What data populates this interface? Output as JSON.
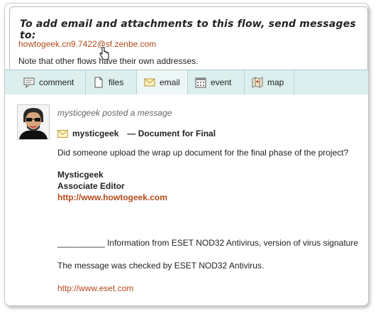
{
  "info": {
    "title": "To add email and attachments to this flow, send messages to:",
    "email_address": "howtogeek.cn9.7422@sf.zenbe.com",
    "note": "Note that other flows have their own addresses."
  },
  "tabs": [
    {
      "label": "comment",
      "icon": "comment-icon",
      "active": false
    },
    {
      "label": "files",
      "icon": "file-icon",
      "active": false
    },
    {
      "label": "email",
      "icon": "envelope-icon",
      "active": true
    },
    {
      "label": "event",
      "icon": "calendar-icon",
      "active": false
    },
    {
      "label": "map",
      "icon": "map-icon",
      "active": false
    }
  ],
  "post": {
    "header": "mysticgeek posted a message",
    "sender": "mysticgeek",
    "subject": "— Document for Final",
    "body": "Did someone upload the wrap up document for the final phase of the project?",
    "signature_name": "Mysticgeek",
    "signature_title": "Associate Editor",
    "signature_link": "http://www.howtogeek.com",
    "antivirus_line": "__________ Information from ESET NOD32 Antivirus, version of virus signature",
    "checked_line": "The message was checked by ESET NOD32 Antivirus.",
    "eset_link": "http://www.eset.com"
  },
  "colors": {
    "link": "#b24a1b",
    "tab_bar": "#dcefee",
    "tab_active": "#eef7f7"
  }
}
